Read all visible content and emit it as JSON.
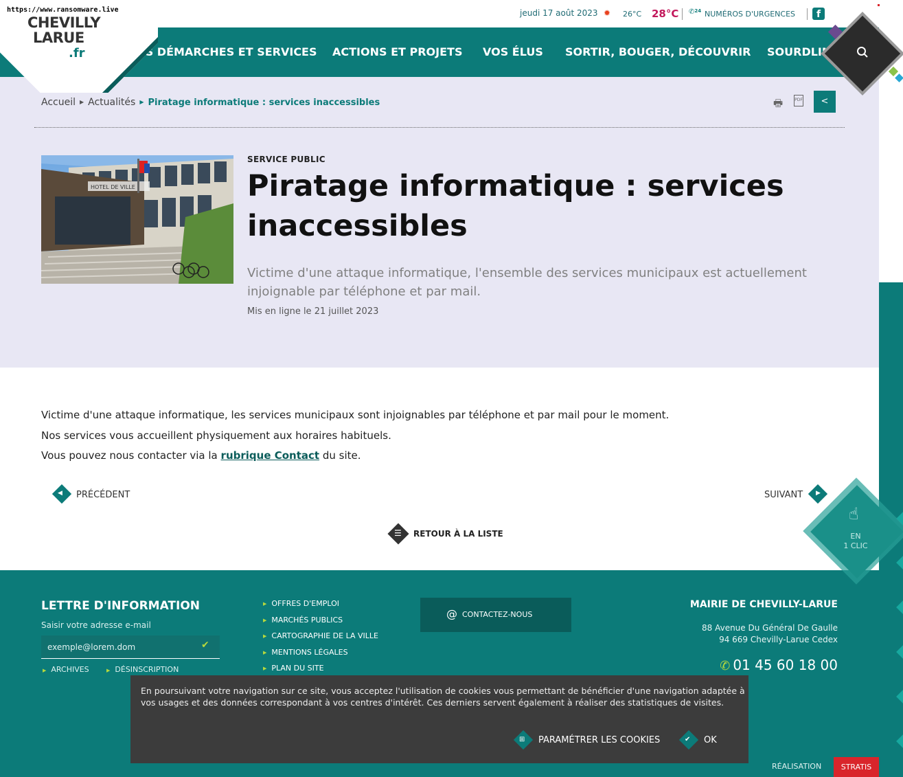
{
  "url_overlay": "https://www.ransomware.live",
  "topbar": {
    "date": "jeudi 17 août 2023",
    "temp_low": "26°C",
    "temp_high": "28°C",
    "urgence_badge": "24",
    "urgence_label": "NUMÉROS D'URGENCES",
    "facebook_glyph": "f"
  },
  "logo": {
    "line1": "CHEVILLY",
    "line2": "LARUE",
    "suffix": ".fr"
  },
  "nav": [
    "VOS DÉMARCHES ET SERVICES",
    "ACTIONS ET PROJETS",
    "VOS ÉLUS",
    "SORTIR, BOUGER, DÉCOUVRIR",
    "SOURDLINE"
  ],
  "breadcrumb": {
    "home": "Accueil",
    "section": "Actualités",
    "current": "Piratage informatique : services inaccessibles"
  },
  "article": {
    "category": "SERVICE PUBLIC",
    "title": "Piratage informatique : services inaccessibles",
    "lead": "Victime d'une attaque informatique, l'ensemble des services municipaux est actuellement injoignable par téléphone et par mail.",
    "published": "Mis en ligne le 21 juillet 2023",
    "image_building_text": "HOTEL DE VILLE",
    "body": {
      "p1": "Victime d'une attaque informatique, les services municipaux sont injoignables par téléphone et par mail pour le moment.",
      "p2": "Nos services vous accueillent physiquement aux horaires habituels.",
      "p3_before": "Vous pouvez nous contacter via la",
      "p3_link": "rubrique Contact",
      "p3_after": "du site."
    }
  },
  "pager": {
    "prev": "PRÉCÉDENT",
    "next": "SUIVANT",
    "back": "RETOUR À LA LISTE"
  },
  "en1clic": {
    "line1": "EN",
    "line2": "1 CLIC"
  },
  "footer": {
    "newsletter": {
      "title": "LETTRE D'INFORMATION",
      "label": "Saisir votre adresse e-mail",
      "placeholder": "exemple@lorem.dom",
      "archives": "ARCHIVES",
      "unsubscribe": "DÉSINSCRIPTION"
    },
    "links": [
      "OFFRES D'EMPLOI",
      "MARCHÉS PUBLICS",
      "CARTOGRAPHIE DE LA VILLE",
      "MENTIONS LÉGALES",
      "PLAN DU SITE"
    ],
    "contact_button": "CONTACTEZ-NOUS",
    "mairie": {
      "title": "MAIRIE DE CHEVILLY-LARUE",
      "address1": "88 Avenue Du Général De Gaulle",
      "address2": "94 669 Chevilly-Larue Cedex",
      "phone": "01 45 60 18 00"
    },
    "realisation": "RÉALISATION",
    "stratis": "STRATIS"
  },
  "cookie": {
    "text": "En poursuivant votre navigation sur ce site, vous acceptez l'utilisation de cookies vous permettant de bénéficier d'une navigation adaptée à vos usages et des données correspondant à vos centres d'intérêt. Ces derniers servent également à réaliser des statistiques de visites.",
    "settings": "PARAMÉTRER LES COOKIES",
    "ok": "OK"
  },
  "colors": {
    "teal": "#0c7b79",
    "dark_teal": "#0a5c5a",
    "hero_bg": "#e8e7f4",
    "accent_red": "#d9252b",
    "lime": "#b6d83d"
  }
}
